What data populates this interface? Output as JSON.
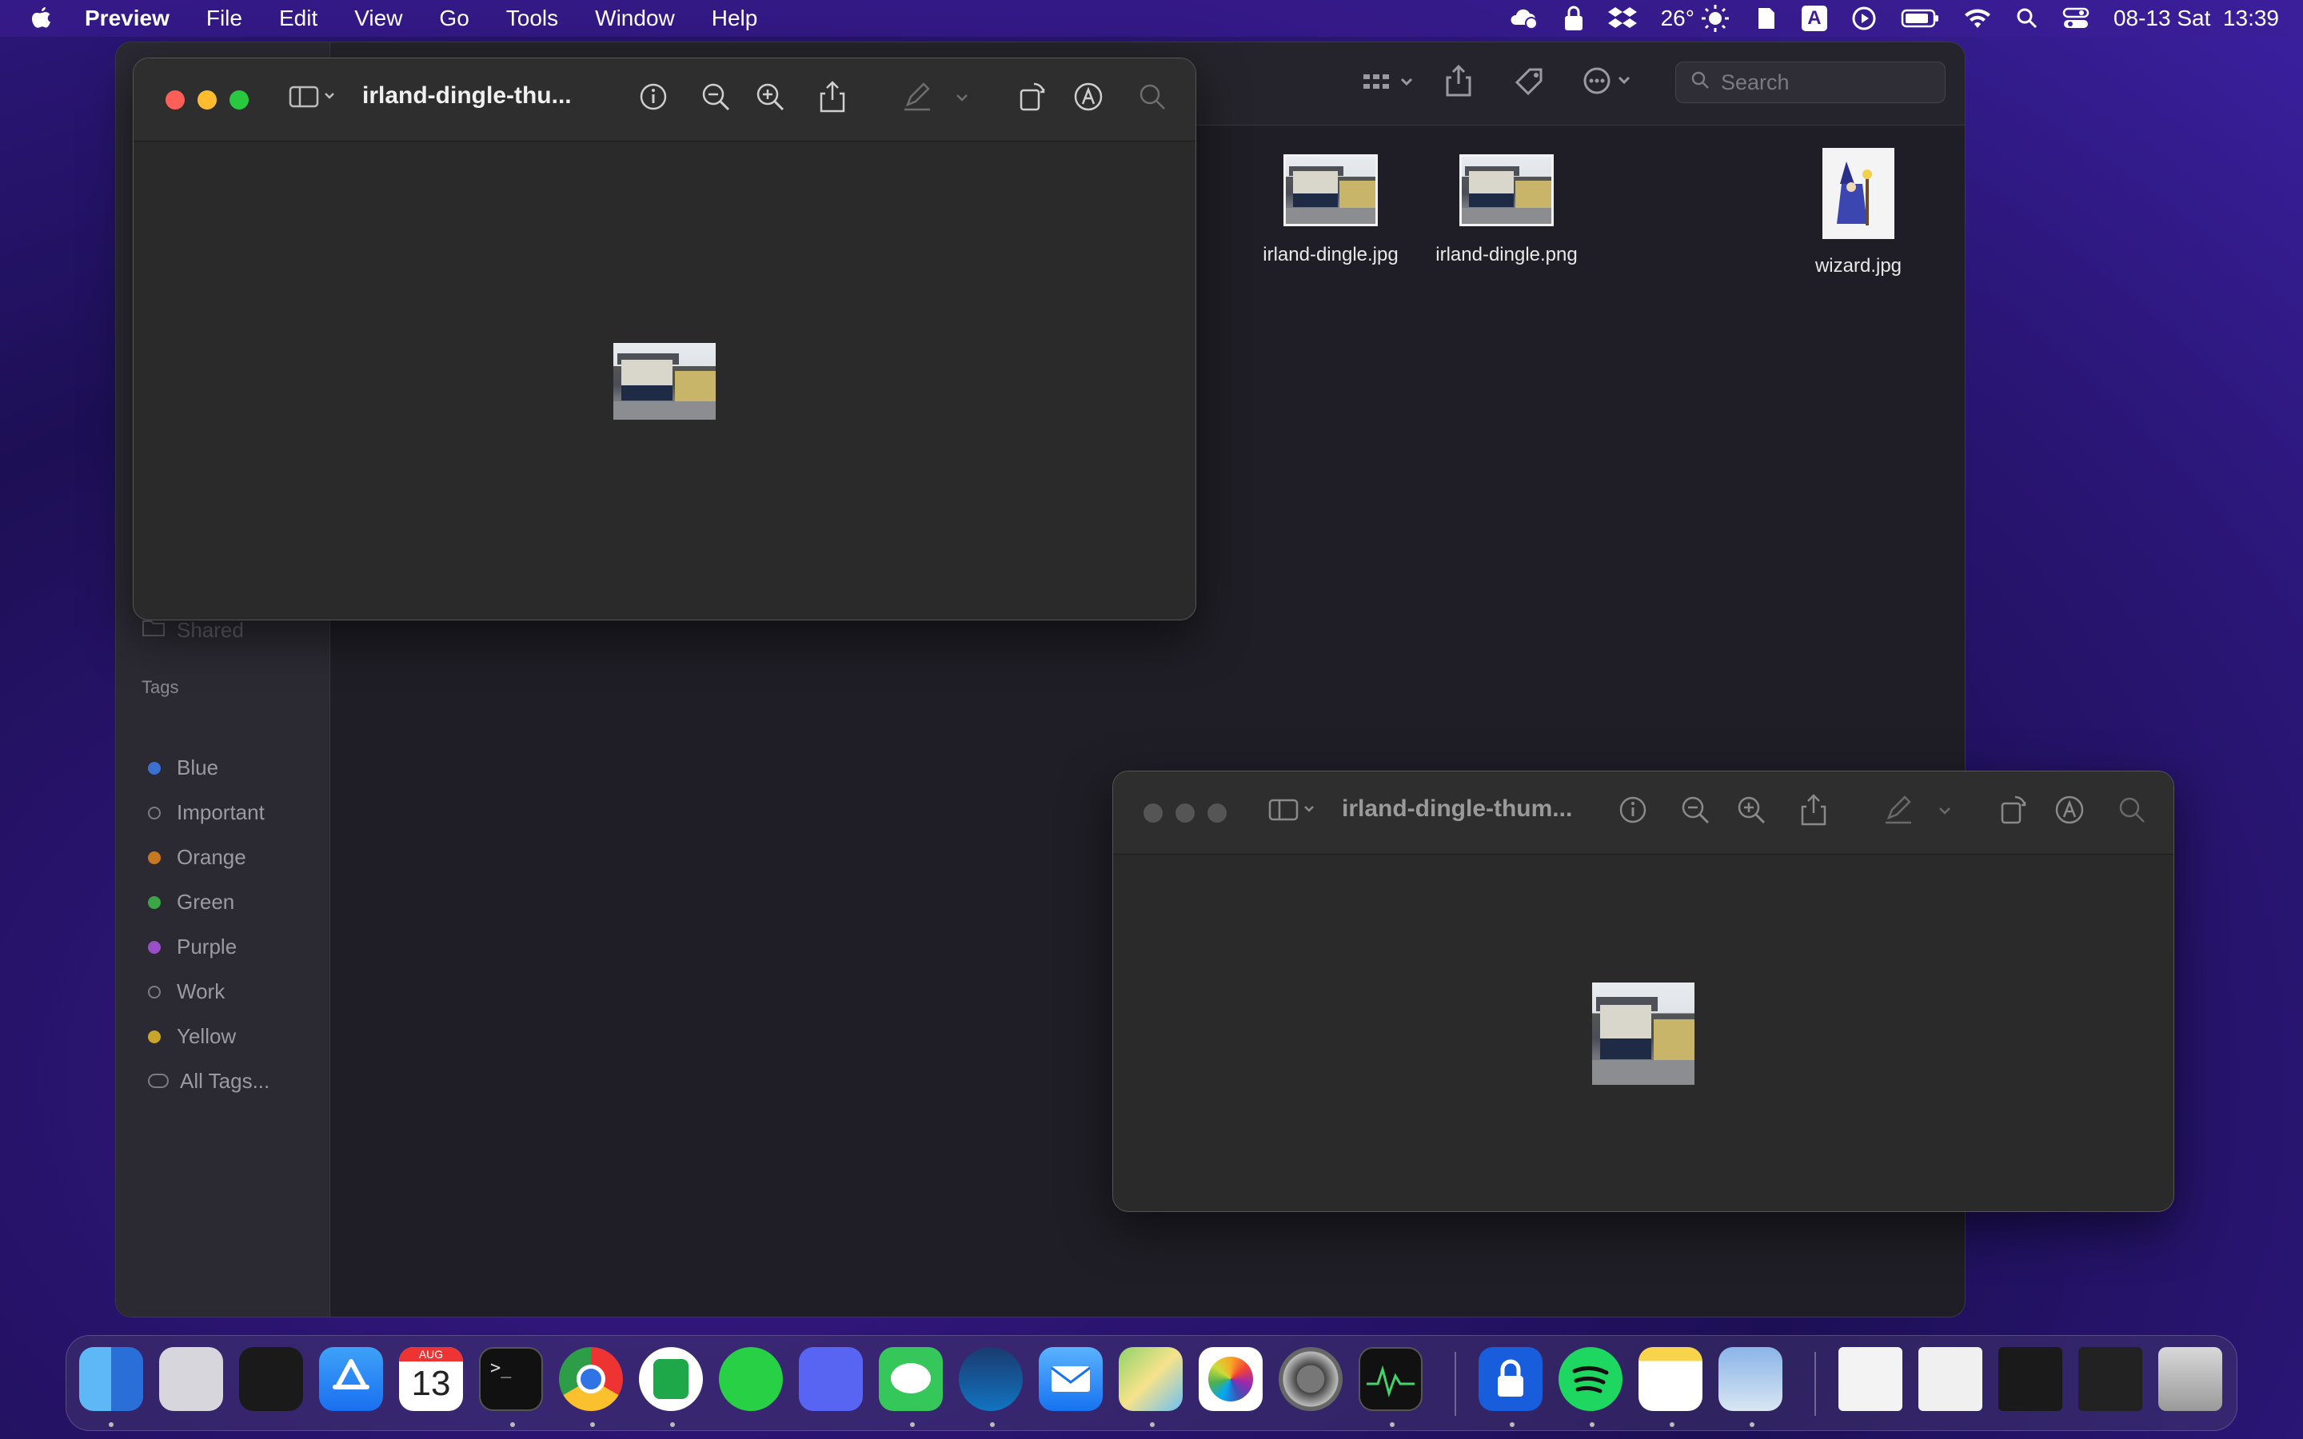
{
  "menubar": {
    "app_name": "Preview",
    "menus": [
      "File",
      "Edit",
      "View",
      "Go",
      "Tools",
      "Window",
      "Help"
    ],
    "temperature": "26°",
    "datetime": "08-13 Sat  13:39",
    "input_source": "A"
  },
  "finder": {
    "search_placeholder": "Search",
    "sidebar": {
      "shared_label": "Shared",
      "tags_header": "Tags",
      "tags": [
        {
          "label": "Blue",
          "color": "#3b6fd1"
        },
        {
          "label": "Important",
          "color": ""
        },
        {
          "label": "Orange",
          "color": "#c8791f"
        },
        {
          "label": "Green",
          "color": "#3aa645"
        },
        {
          "label": "Purple",
          "color": "#9b4fc6"
        },
        {
          "label": "Work",
          "color": ""
        },
        {
          "label": "Yellow",
          "color": "#c9a62a"
        }
      ],
      "all_tags_label": "All Tags..."
    },
    "files": [
      {
        "name": "irland-dingle.jpg"
      },
      {
        "name": "irland-dingle.png"
      },
      {
        "name": "wizard.jpg"
      }
    ]
  },
  "preview_front": {
    "title": "irland-dingle-thu..."
  },
  "preview_back": {
    "title": "irland-dingle-thum..."
  },
  "calendar_icon": {
    "month": "AUG",
    "day": "13"
  },
  "dock": {
    "apps": [
      "finder-icon",
      "launchpad-icon",
      "mission-control-icon",
      "app-store-icon",
      "calendar-icon",
      "terminal-icon",
      "chrome-icon",
      "evernote-icon",
      "whatsapp-icon",
      "discord-icon",
      "messages-icon",
      "steam-icon",
      "mail-icon",
      "maps-icon",
      "photos-icon",
      "system-preferences-icon",
      "activity-monitor-icon",
      "bitwarden-icon",
      "spotify-icon",
      "notes-icon",
      "preview-icon"
    ]
  }
}
